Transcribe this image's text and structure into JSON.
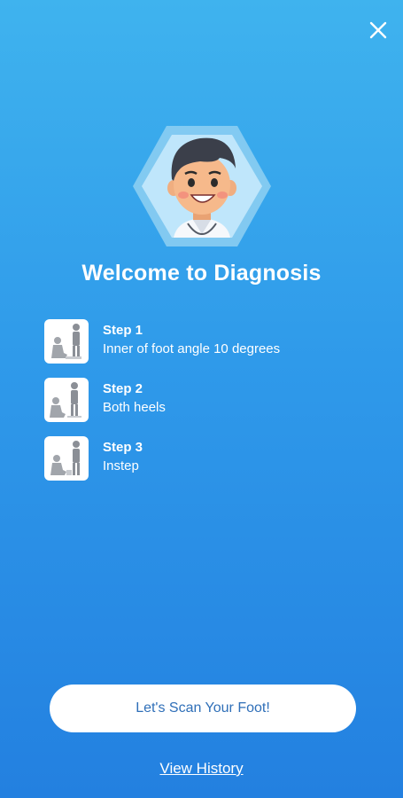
{
  "header": {
    "close_icon": "close-icon"
  },
  "welcome": {
    "title": "Welcome to Diagnosis",
    "avatar_icon": "doctor-avatar"
  },
  "steps": [
    {
      "title": "Step 1",
      "desc": "Inner of foot angle 10 degrees",
      "icon": "foot-scan-illustration"
    },
    {
      "title": "Step 2",
      "desc": "Both heels",
      "icon": "foot-scan-illustration"
    },
    {
      "title": "Step 3",
      "desc": "Instep",
      "icon": "foot-scan-illustration"
    }
  ],
  "actions": {
    "scan_label": "Let's Scan Your Foot!",
    "history_label": "View History"
  },
  "colors": {
    "bg_top": "#3fb3ee",
    "bg_bottom": "#2380e0",
    "button_text": "#2f6fb8"
  }
}
